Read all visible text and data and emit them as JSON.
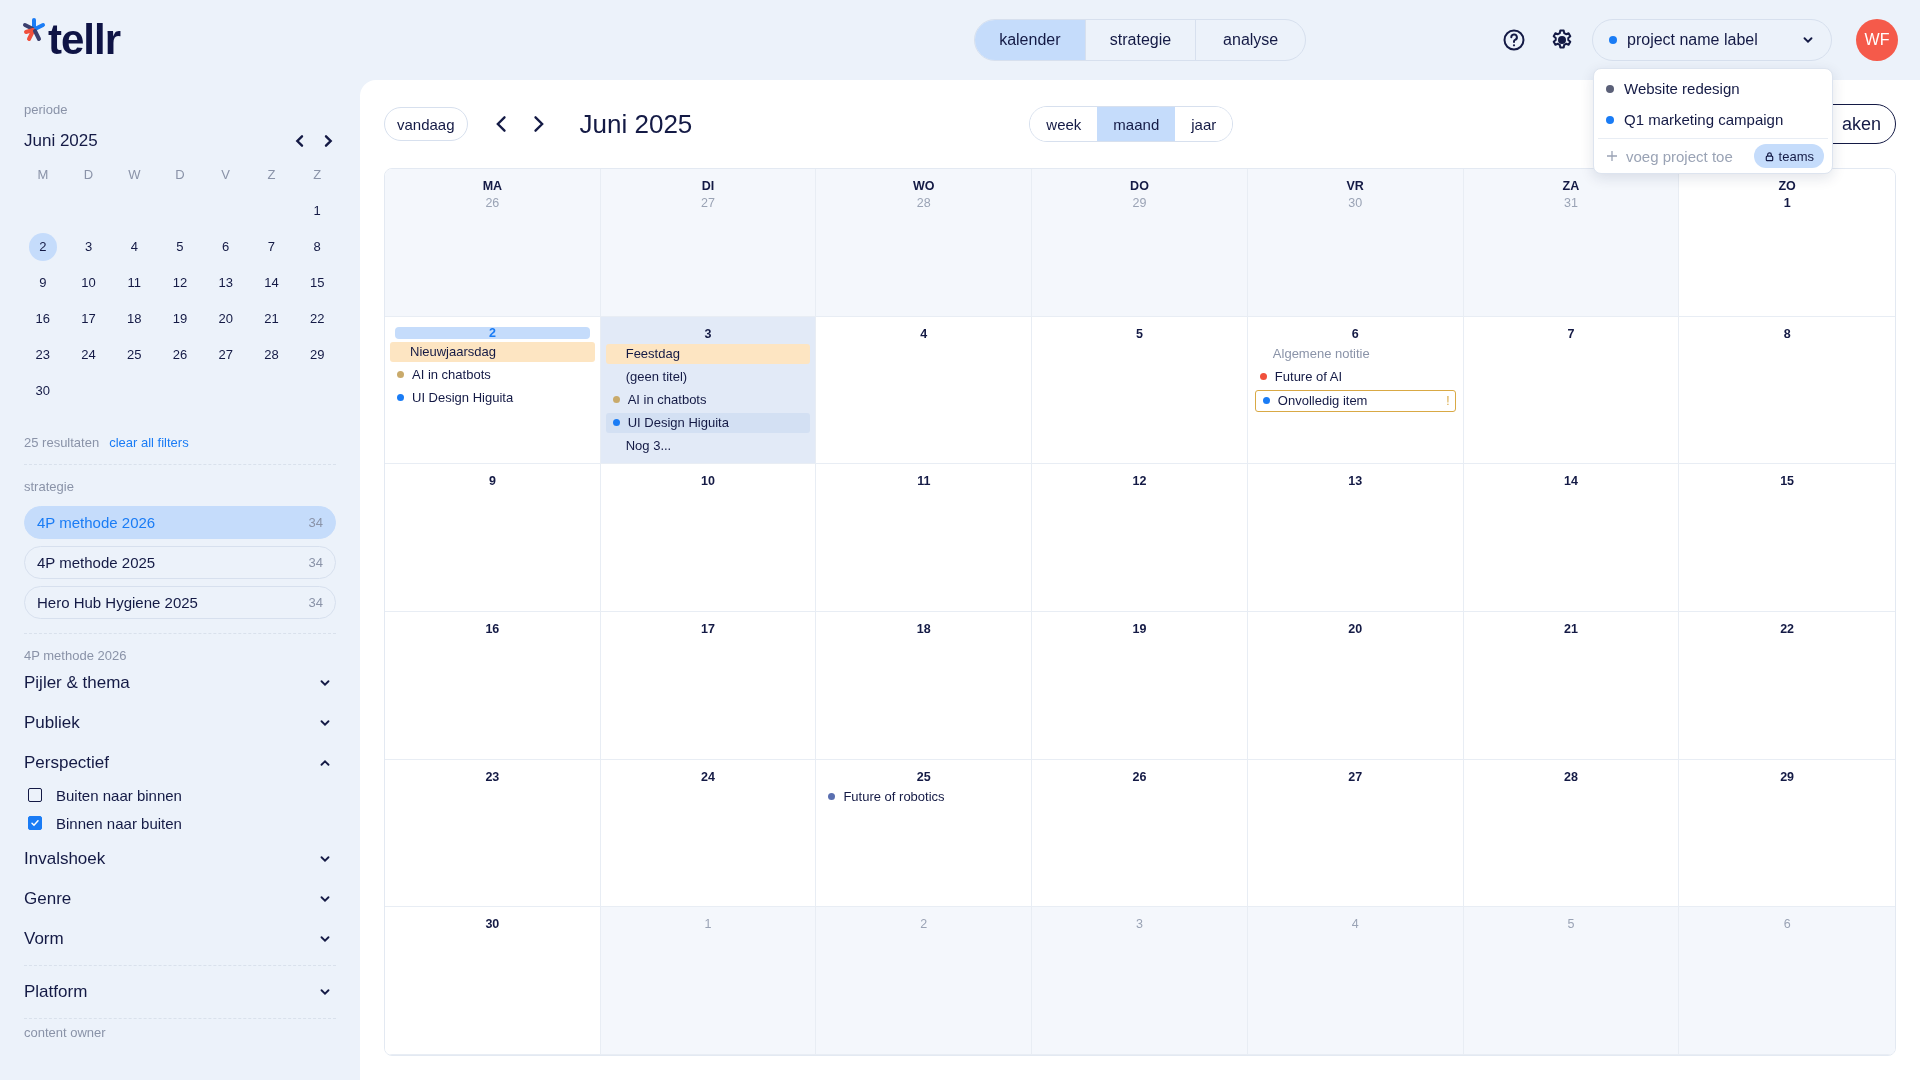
{
  "logo": "tellr",
  "nav_tabs": [
    {
      "label": "kalender",
      "selected": true
    },
    {
      "label": "strategie",
      "selected": false
    },
    {
      "label": "analyse",
      "selected": false
    }
  ],
  "project_selector": {
    "label": "project name label",
    "color": "#1a7cf5"
  },
  "project_menu": {
    "items": [
      {
        "label": "Website redesign",
        "color": "#5b6078"
      },
      {
        "label": "Q1 marketing campaign",
        "color": "#1a7cf5"
      }
    ],
    "add_label": "voeg project toe",
    "teams_badge": "teams"
  },
  "avatar": "WF",
  "sidebar": {
    "period_label": "periode",
    "mini_calendar": {
      "title": "Juni 2025",
      "weekdays": [
        "M",
        "D",
        "W",
        "D",
        "V",
        "Z",
        "Z"
      ],
      "weeks": [
        {
          "kind": "partial-start",
          "days": [
            {
              "label": "1",
              "selected": false
            }
          ]
        },
        {
          "kind": "full",
          "days": [
            {
              "label": "2",
              "selected": true
            },
            {
              "label": "3",
              "selected": false
            },
            {
              "label": "4",
              "selected": false
            },
            {
              "label": "5",
              "selected": false
            },
            {
              "label": "6",
              "selected": false
            },
            {
              "label": "7",
              "selected": false
            },
            {
              "label": "8",
              "selected": false
            }
          ]
        },
        {
          "kind": "full",
          "days": [
            {
              "label": "9",
              "selected": false
            },
            {
              "label": "10",
              "selected": false
            },
            {
              "label": "11",
              "selected": false
            },
            {
              "label": "12",
              "selected": false
            },
            {
              "label": "13",
              "selected": false
            },
            {
              "label": "14",
              "selected": false
            },
            {
              "label": "15",
              "selected": false
            }
          ]
        },
        {
          "kind": "full",
          "days": [
            {
              "label": "16",
              "selected": false
            },
            {
              "label": "17",
              "selected": false
            },
            {
              "label": "18",
              "selected": false
            },
            {
              "label": "19",
              "selected": false
            },
            {
              "label": "20",
              "selected": false
            },
            {
              "label": "21",
              "selected": false
            },
            {
              "label": "22",
              "selected": false
            }
          ]
        },
        {
          "kind": "full",
          "days": [
            {
              "label": "23",
              "selected": false
            },
            {
              "label": "24",
              "selected": false
            },
            {
              "label": "25",
              "selected": false
            },
            {
              "label": "26",
              "selected": false
            },
            {
              "label": "27",
              "selected": false
            },
            {
              "label": "28",
              "selected": false
            },
            {
              "label": "29",
              "selected": false
            }
          ]
        },
        {
          "kind": "partial-end",
          "days": [
            {
              "label": "30",
              "selected": false
            }
          ]
        }
      ]
    },
    "results": "25 resultaten",
    "clear_filters": "clear all filters",
    "strategy_label": "strategie",
    "strategies": [
      {
        "label": "4P methode 2026",
        "count": "34",
        "selected": true
      },
      {
        "label": "4P methode 2025",
        "count": "34",
        "selected": false
      },
      {
        "label": "Hero Hub Hygiene 2025",
        "count": "34",
        "selected": false
      }
    ],
    "filter_title": "4P methode 2026",
    "filter_groups": [
      [
        {
          "label": "Pijler & thema",
          "expanded": false
        },
        {
          "label": "Publiek",
          "expanded": false
        },
        {
          "label": "Perspectief",
          "expanded": true,
          "options": [
            {
              "label": "Buiten naar binnen",
              "checked": false
            },
            {
              "label": "Binnen naar buiten",
              "checked": true
            }
          ]
        },
        {
          "label": "Invalshoek",
          "expanded": false
        },
        {
          "label": "Genre",
          "expanded": false
        },
        {
          "label": "Vorm",
          "expanded": false
        }
      ],
      [
        {
          "label": "Platform",
          "expanded": false
        }
      ]
    ],
    "owner_label": "content owner"
  },
  "toolbar": {
    "today": "vandaag",
    "title": "Juni 2025",
    "views": [
      {
        "label": "week",
        "selected": false
      },
      {
        "label": "maand",
        "selected": true
      },
      {
        "label": "jaar",
        "selected": false
      }
    ],
    "create_button": "aken"
  },
  "calendar": {
    "weekdays": [
      "MA",
      "DI",
      "WO",
      "DO",
      "VR",
      "ZA",
      "ZO"
    ],
    "weeks": [
      {
        "days": [
          {
            "label": "26",
            "in_month": false,
            "selected": false,
            "hovered": false
          },
          {
            "label": "27",
            "in_month": false,
            "selected": false,
            "hovered": false
          },
          {
            "label": "28",
            "in_month": false,
            "selected": false,
            "hovered": false
          },
          {
            "label": "29",
            "in_month": false,
            "selected": false,
            "hovered": false
          },
          {
            "label": "30",
            "in_month": false,
            "selected": false,
            "hovered": false
          },
          {
            "label": "31",
            "in_month": false,
            "selected": false,
            "hovered": false
          },
          {
            "label": "1",
            "in_month": true,
            "selected": false,
            "hovered": false
          }
        ]
      },
      {
        "days": [
          {
            "label": "2",
            "in_month": true,
            "selected": true,
            "hovered": false,
            "events": [
              {
                "kind": "holiday",
                "label": "Nieuwjaarsdag",
                "hovered": false
              },
              {
                "kind": "dot",
                "label": "AI in chatbots",
                "color": "#c9aa6b",
                "hovered": false
              },
              {
                "kind": "dot",
                "label": "UI Design Higuita",
                "color": "#1a7cf5",
                "hovered": false
              }
            ]
          },
          {
            "label": "3",
            "in_month": true,
            "selected": false,
            "hovered": true,
            "events": [
              {
                "kind": "holiday",
                "label": "Feestdag",
                "hovered": false
              },
              {
                "kind": "plain",
                "label": "(geen titel)",
                "hovered": false
              },
              {
                "kind": "dot",
                "label": "AI in chatbots",
                "color": "#c9aa6b",
                "hovered": false
              },
              {
                "kind": "dot",
                "label": "UI Design Higuita",
                "color": "#1a7cf5",
                "hovered": true
              },
              {
                "kind": "more",
                "label": "Nog 3...",
                "hovered": false
              }
            ]
          },
          {
            "label": "4",
            "in_month": true,
            "selected": false,
            "hovered": false
          },
          {
            "label": "5",
            "in_month": true,
            "selected": false,
            "hovered": false
          },
          {
            "label": "6",
            "in_month": true,
            "selected": false,
            "hovered": false,
            "events": [
              {
                "kind": "note",
                "label": "Algemene notitie",
                "hovered": false
              },
              {
                "kind": "dot",
                "label": "Future of AI",
                "color": "#f0503c",
                "hovered": false
              },
              {
                "kind": "incomplete",
                "label": "Onvolledig item",
                "color": "#1a7cf5",
                "flag": "!",
                "hovered": false
              }
            ]
          },
          {
            "label": "7",
            "in_month": true,
            "selected": false,
            "hovered": false
          },
          {
            "label": "8",
            "in_month": true,
            "selected": false,
            "hovered": false
          }
        ]
      },
      {
        "days": [
          {
            "label": "9",
            "in_month": true,
            "selected": false,
            "hovered": false
          },
          {
            "label": "10",
            "in_month": true,
            "selected": false,
            "hovered": false
          },
          {
            "label": "11",
            "in_month": true,
            "selected": false,
            "hovered": false
          },
          {
            "label": "12",
            "in_month": true,
            "selected": false,
            "hovered": false
          },
          {
            "label": "13",
            "in_month": true,
            "selected": false,
            "hovered": false
          },
          {
            "label": "14",
            "in_month": true,
            "selected": false,
            "hovered": false
          },
          {
            "label": "15",
            "in_month": true,
            "selected": false,
            "hovered": false
          }
        ]
      },
      {
        "days": [
          {
            "label": "16",
            "in_month": true,
            "selected": false,
            "hovered": false
          },
          {
            "label": "17",
            "in_month": true,
            "selected": false,
            "hovered": false
          },
          {
            "label": "18",
            "in_month": true,
            "selected": false,
            "hovered": false
          },
          {
            "label": "19",
            "in_month": true,
            "selected": false,
            "hovered": false
          },
          {
            "label": "20",
            "in_month": true,
            "selected": false,
            "hovered": false
          },
          {
            "label": "21",
            "in_month": true,
            "selected": false,
            "hovered": false
          },
          {
            "label": "22",
            "in_month": true,
            "selected": false,
            "hovered": false
          }
        ]
      },
      {
        "days": [
          {
            "label": "23",
            "in_month": true,
            "selected": false,
            "hovered": false
          },
          {
            "label": "24",
            "in_month": true,
            "selected": false,
            "hovered": false
          },
          {
            "label": "25",
            "in_month": true,
            "selected": false,
            "hovered": false,
            "events": [
              {
                "kind": "dot",
                "label": "Future of robotics",
                "color": "#5a6fb0",
                "hovered": false
              }
            ]
          },
          {
            "label": "26",
            "in_month": true,
            "selected": false,
            "hovered": false
          },
          {
            "label": "27",
            "in_month": true,
            "selected": false,
            "hovered": false
          },
          {
            "label": "28",
            "in_month": true,
            "selected": false,
            "hovered": false
          },
          {
            "label": "29",
            "in_month": true,
            "selected": false,
            "hovered": false
          }
        ]
      },
      {
        "days": [
          {
            "label": "30",
            "in_month": true,
            "selected": false,
            "hovered": false
          },
          {
            "label": "1",
            "in_month": false,
            "selected": false,
            "hovered": false
          },
          {
            "label": "2",
            "in_month": false,
            "selected": false,
            "hovered": false
          },
          {
            "label": "3",
            "in_month": false,
            "selected": false,
            "hovered": false
          },
          {
            "label": "4",
            "in_month": false,
            "selected": false,
            "hovered": false
          },
          {
            "label": "5",
            "in_month": false,
            "selected": false,
            "hovered": false
          },
          {
            "label": "6",
            "in_month": false,
            "selected": false,
            "hovered": false
          }
        ]
      }
    ]
  }
}
